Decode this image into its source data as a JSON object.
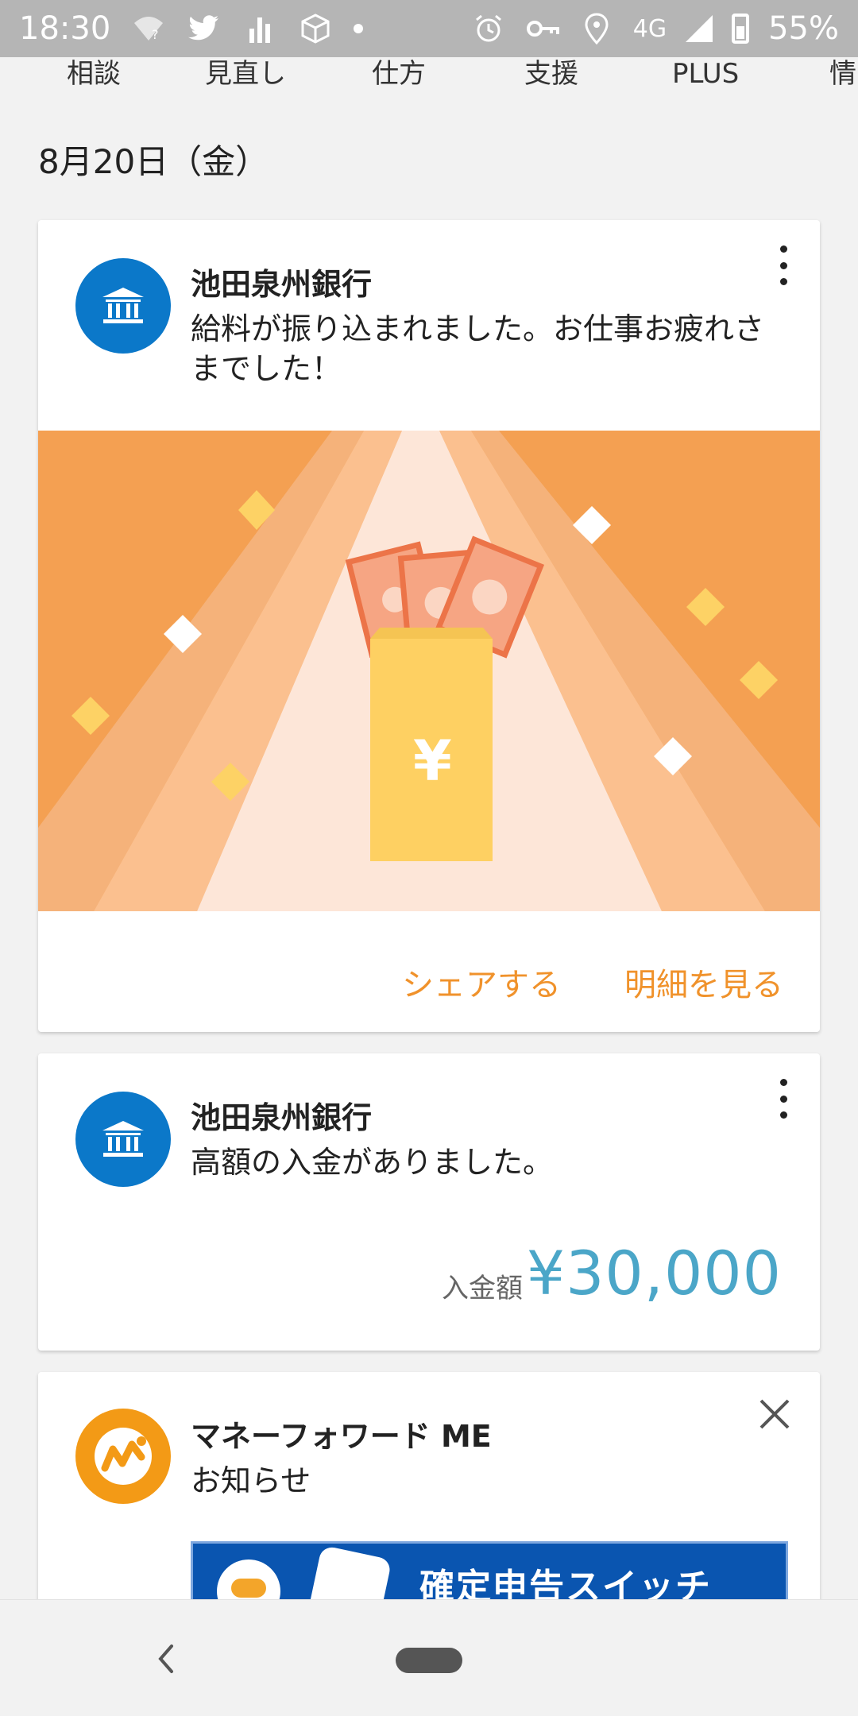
{
  "status_bar": {
    "time": "18:30",
    "network": "4G",
    "battery": "55%",
    "icons": [
      "wifi-question-icon",
      "twitter-icon",
      "chart-icon",
      "box-icon",
      "dot-icon",
      "alarm-icon",
      "key-icon",
      "location-icon",
      "signal-icon",
      "battery-icon"
    ]
  },
  "tabs": [
    "相談",
    "見直し",
    "仕方",
    "支援",
    "PLUS",
    "情"
  ],
  "date": "8月20日（金）",
  "cards": [
    {
      "title": "池田泉州銀行",
      "message": "給料が振り込まれました。お仕事お疲れさまでした！",
      "actions": {
        "share": "シェアする",
        "detail": "明細を見る"
      },
      "illustration": {
        "symbol": "¥"
      }
    },
    {
      "title": "池田泉州銀行",
      "message": "高額の入金がありました。",
      "amount_label": "入金額",
      "amount_value": "¥30,000"
    },
    {
      "title": "マネーフォワード ME",
      "message": "お知らせ",
      "banner_text": "確定申告スイッチ"
    }
  ],
  "colors": {
    "accent_orange": "#f0922b",
    "amount_blue": "#4ba6c8",
    "bank_blue": "#0b78c9",
    "mf_orange": "#f39a16"
  }
}
